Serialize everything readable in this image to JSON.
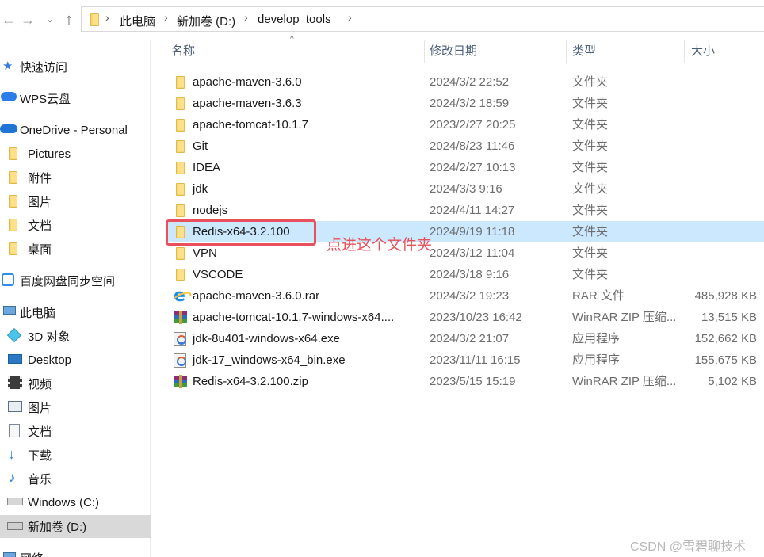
{
  "address_bar": {
    "crumbs": [
      "此电脑",
      "新加卷 (D:)",
      "develop_tools"
    ]
  },
  "nav_pane": {
    "items": [
      {
        "label": "快速访问",
        "icon": "star-icon"
      },
      {
        "label": "WPS云盘",
        "icon": "cloud-icon"
      },
      {
        "label": "OneDrive - Personal",
        "icon": "onedrive-icon"
      },
      {
        "label": "Pictures",
        "icon": "folder-icon"
      },
      {
        "label": "附件",
        "icon": "folder-icon"
      },
      {
        "label": "图片",
        "icon": "folder-icon"
      },
      {
        "label": "文档",
        "icon": "folder-icon"
      },
      {
        "label": "桌面",
        "icon": "folder-icon"
      },
      {
        "label": "百度网盘同步空间",
        "icon": "baidu-sync-icon"
      },
      {
        "label": "此电脑",
        "icon": "computer-icon"
      },
      {
        "label": "3D 对象",
        "icon": "cube-icon"
      },
      {
        "label": "Desktop",
        "icon": "desktop-icon"
      },
      {
        "label": "视频",
        "icon": "video-icon"
      },
      {
        "label": "图片",
        "icon": "picture-icon"
      },
      {
        "label": "文档",
        "icon": "document-icon"
      },
      {
        "label": "下载",
        "icon": "download-icon"
      },
      {
        "label": "音乐",
        "icon": "music-icon"
      },
      {
        "label": "Windows  (C:)",
        "icon": "drive-icon"
      },
      {
        "label": "新加卷 (D:)",
        "icon": "drive-icon",
        "selected": true
      },
      {
        "label": "网络",
        "icon": "network-icon"
      }
    ]
  },
  "columns": {
    "name": "名称",
    "date": "修改日期",
    "type": "类型",
    "size": "大小"
  },
  "files": [
    {
      "name": "apache-maven-3.6.0",
      "date": "2024/3/2 22:52",
      "type": "文件夹",
      "size": "",
      "icon": "folder-icon"
    },
    {
      "name": "apache-maven-3.6.3",
      "date": "2024/3/2 18:59",
      "type": "文件夹",
      "size": "",
      "icon": "folder-icon"
    },
    {
      "name": "apache-tomcat-10.1.7",
      "date": "2023/2/27 20:25",
      "type": "文件夹",
      "size": "",
      "icon": "folder-icon"
    },
    {
      "name": "Git",
      "date": "2024/8/23 11:46",
      "type": "文件夹",
      "size": "",
      "icon": "folder-icon"
    },
    {
      "name": "IDEA",
      "date": "2024/2/27 10:13",
      "type": "文件夹",
      "size": "",
      "icon": "folder-icon"
    },
    {
      "name": "jdk",
      "date": "2024/3/3 9:16",
      "type": "文件夹",
      "size": "",
      "icon": "folder-icon"
    },
    {
      "name": "nodejs",
      "date": "2024/4/11 14:27",
      "type": "文件夹",
      "size": "",
      "icon": "folder-icon"
    },
    {
      "name": "Redis-x64-3.2.100",
      "date": "2024/9/19 11:18",
      "type": "文件夹",
      "size": "",
      "icon": "folder-icon",
      "selected": true
    },
    {
      "name": "VPN",
      "date": "2024/3/12 11:04",
      "type": "文件夹",
      "size": "",
      "icon": "folder-icon"
    },
    {
      "name": "VSCODE",
      "date": "2024/3/18 9:16",
      "type": "文件夹",
      "size": "",
      "icon": "folder-icon"
    },
    {
      "name": "apache-maven-3.6.0.rar",
      "date": "2024/3/2 19:23",
      "type": "RAR 文件",
      "size": "485,928 KB",
      "icon": "ie-file-icon"
    },
    {
      "name": "apache-tomcat-10.1.7-windows-x64....",
      "date": "2023/10/23 16:42",
      "type": "WinRAR ZIP 压缩...",
      "size": "13,515 KB",
      "icon": "winrar-icon"
    },
    {
      "name": "jdk-8u401-windows-x64.exe",
      "date": "2024/3/2 21:07",
      "type": "应用程序",
      "size": "152,662 KB",
      "icon": "exe-icon"
    },
    {
      "name": "jdk-17_windows-x64_bin.exe",
      "date": "2023/11/11 16:15",
      "type": "应用程序",
      "size": "155,675 KB",
      "icon": "exe-icon"
    },
    {
      "name": "Redis-x64-3.2.100.zip",
      "date": "2023/5/15 15:19",
      "type": "WinRAR ZIP 压缩...",
      "size": "5,102 KB",
      "icon": "winrar-icon"
    }
  ],
  "annotation": {
    "text": "点进这个文件夹",
    "color": "#e8505b"
  },
  "watermark": "CSDN @雪碧聊技术",
  "colors": {
    "selection": "#cce8ff",
    "nav_selected": "#d9d9d9",
    "header_text": "#4c607a"
  }
}
